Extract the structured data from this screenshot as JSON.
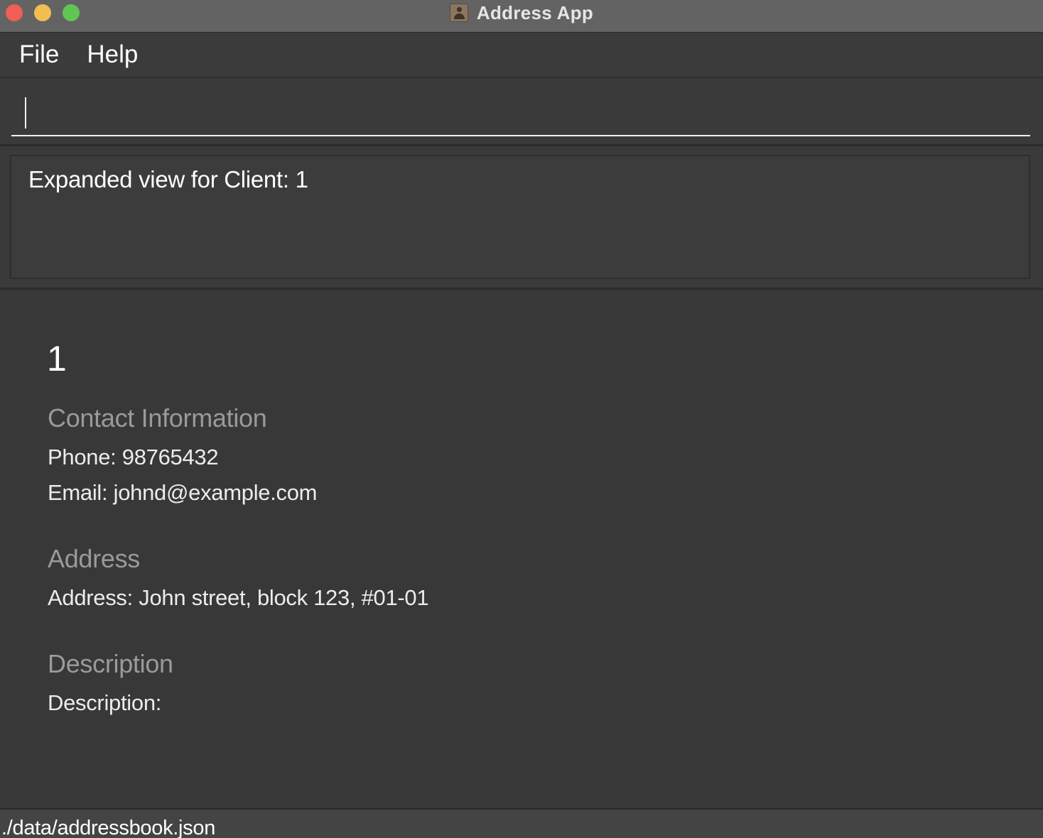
{
  "window": {
    "title": "Address App"
  },
  "menu": {
    "items": [
      "File",
      "Help"
    ]
  },
  "command_box": {
    "value": "",
    "placeholder": ""
  },
  "result_display": {
    "text": "Expanded view for Client: 1"
  },
  "client": {
    "id": "1",
    "contact_heading": "Contact Information",
    "phone": "Phone: 98765432",
    "email": "Email: johnd@example.com",
    "address_heading": "Address",
    "address": "Address: John street, block 123, #01-01",
    "description_heading": "Description",
    "description": "Description:"
  },
  "status_bar": {
    "file_path": "./data/addressbook.json"
  },
  "colors": {
    "background": "#383838",
    "title_bar": "#636363",
    "section_heading": "#9a9a9a",
    "close": "#ee5f57",
    "minimize": "#f4bd4f",
    "maximize": "#61c554"
  },
  "icons": {
    "app": "contacts-book-icon"
  }
}
